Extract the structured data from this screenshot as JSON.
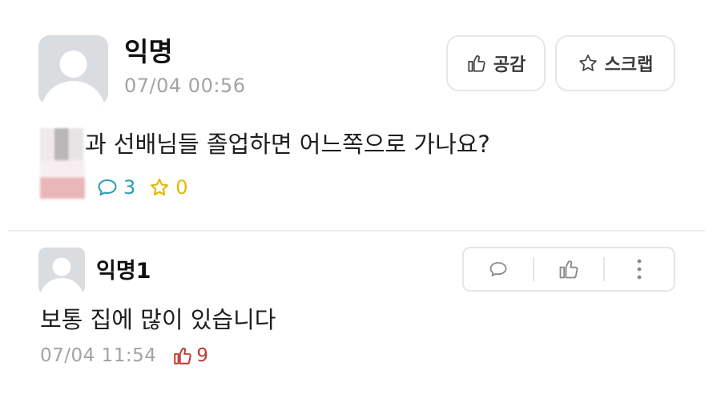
{
  "post": {
    "author": "익명",
    "timestamp": "07/04 00:56",
    "buttons": {
      "like_label": "공감",
      "scrap_label": "스크랩"
    },
    "content": "과 선배님들 졸업하면 어느쪽으로 가나요?",
    "stats": {
      "comments": "3",
      "scraps": "0"
    }
  },
  "comment": {
    "author": "익명1",
    "content": "보통 집에 많이 있습니다",
    "timestamp": "07/04 11:54",
    "likes": "9"
  },
  "colors": {
    "comment_count": "#2b9db1",
    "scrap_count": "#e6b800",
    "like_count": "#c0392b",
    "avatar_bg": "#d9dde0"
  }
}
